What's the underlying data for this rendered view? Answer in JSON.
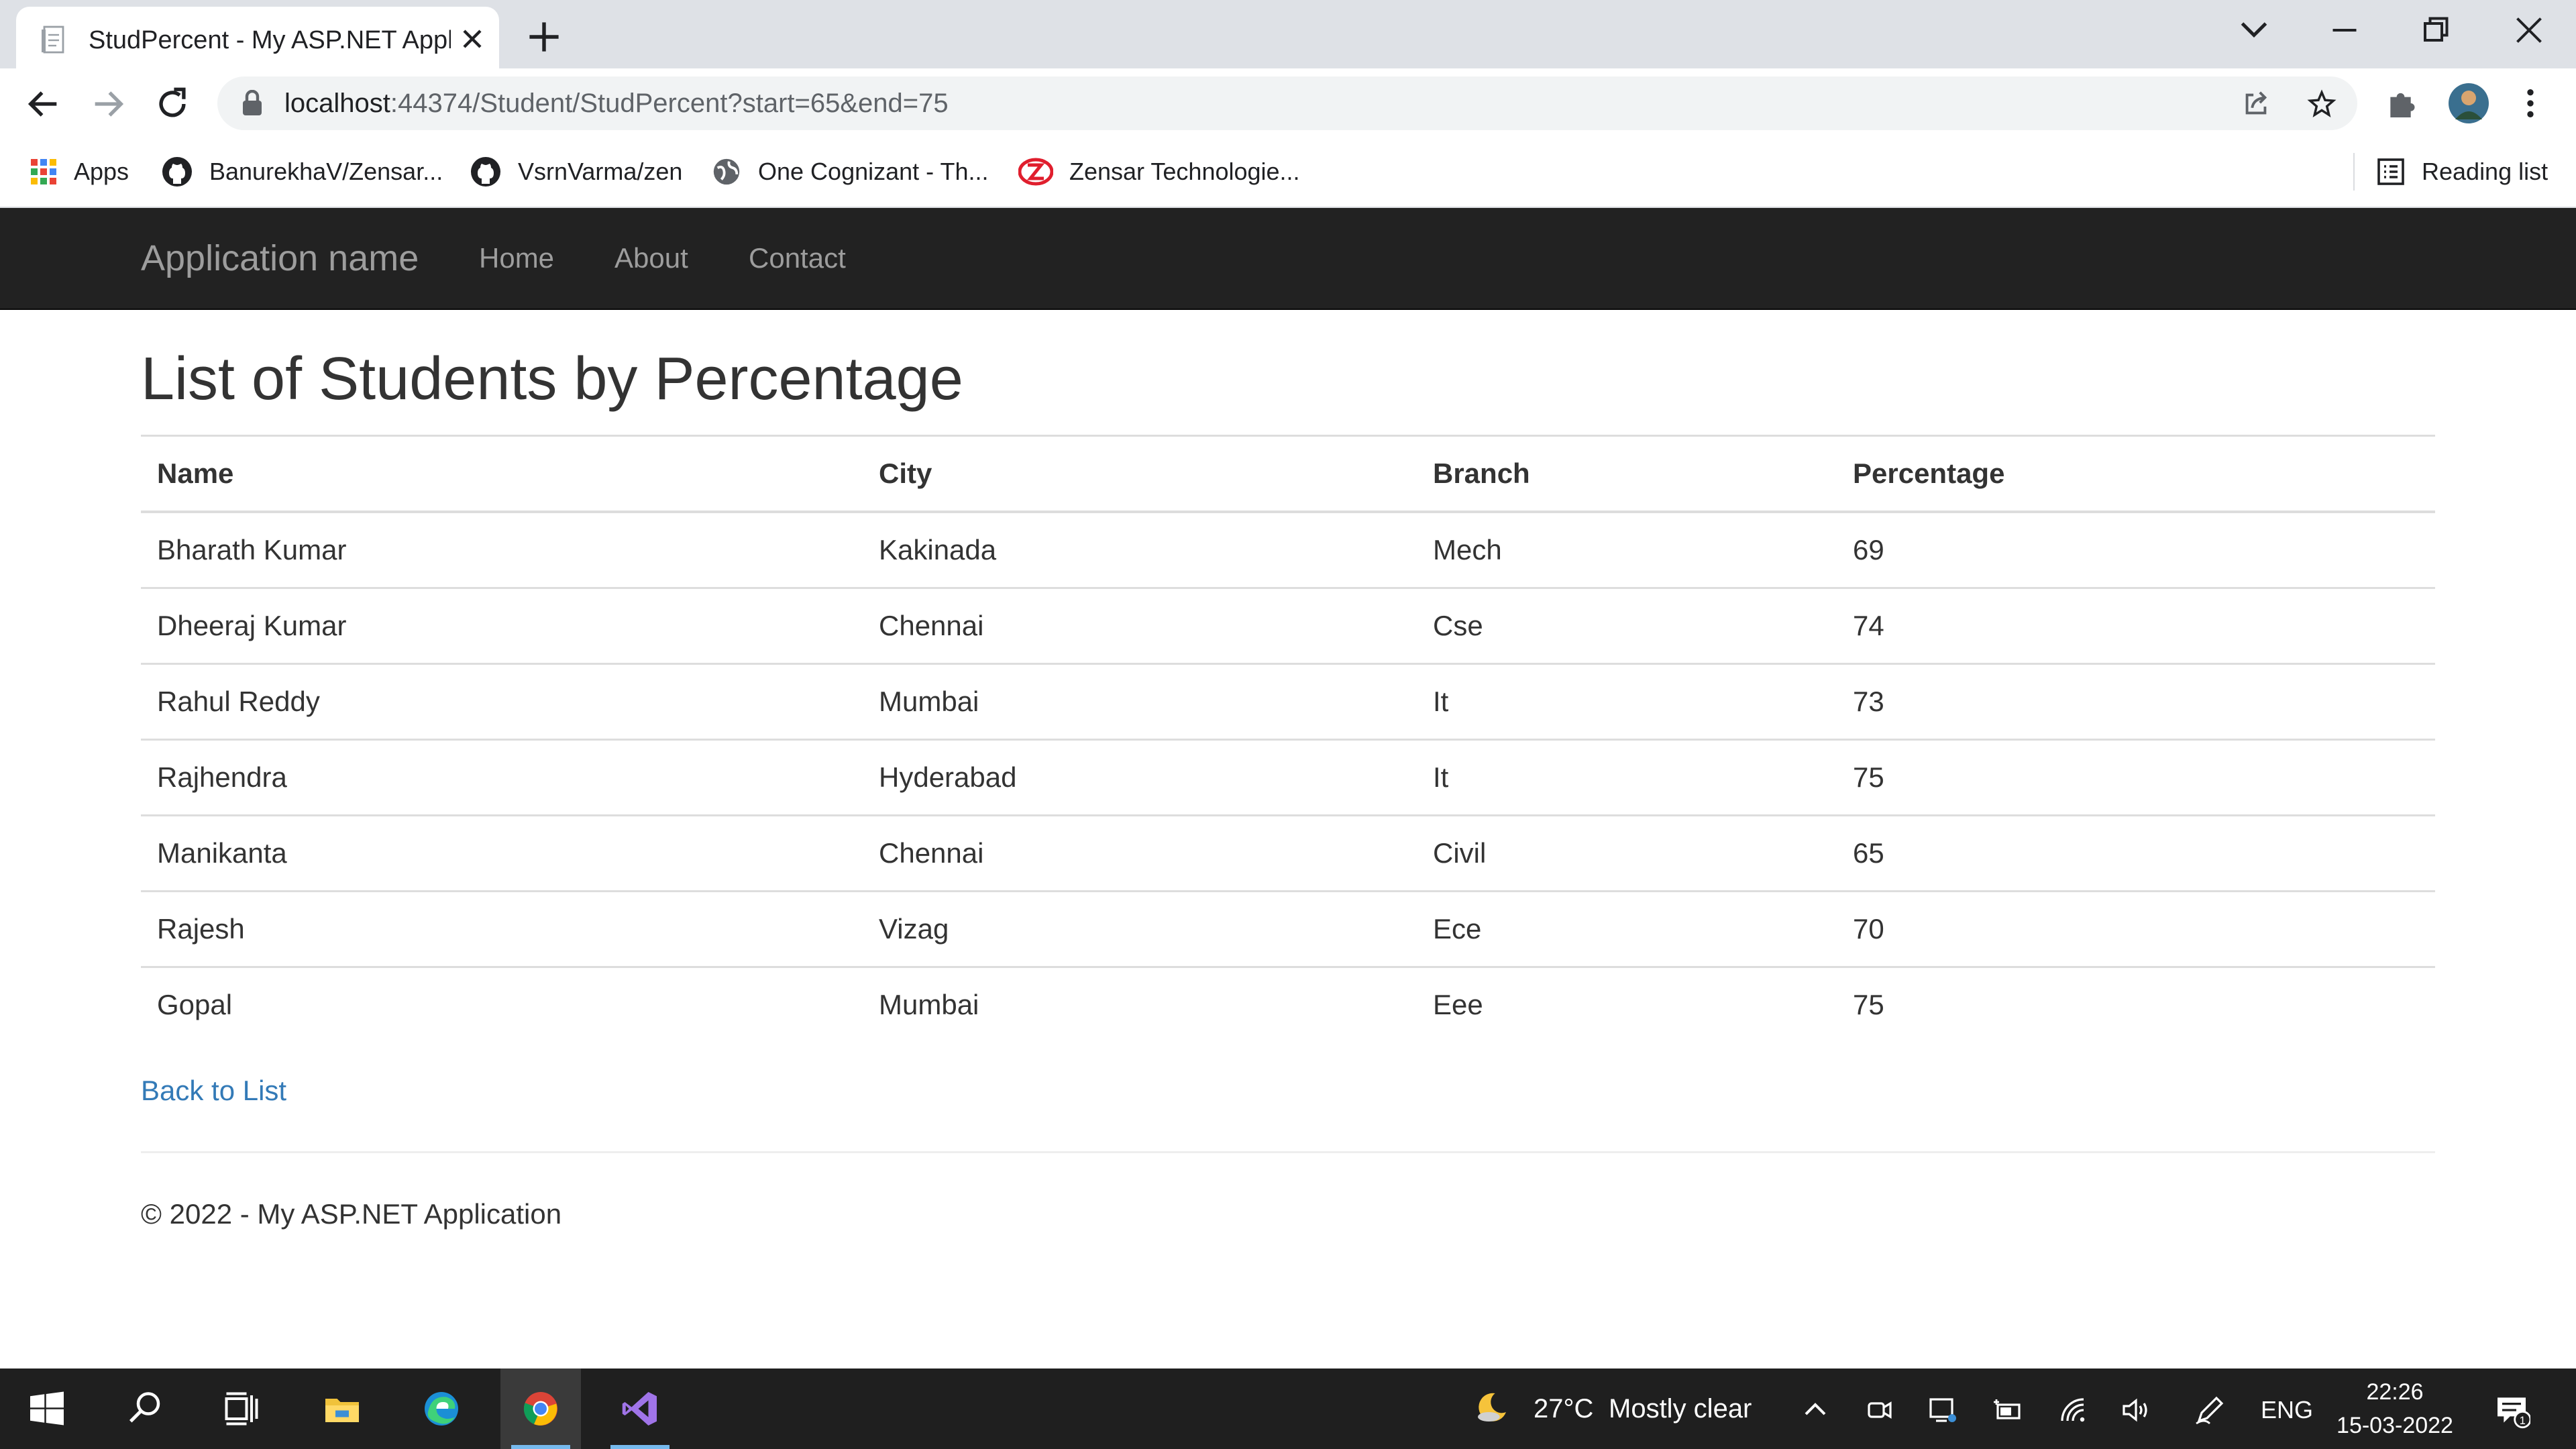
{
  "browser": {
    "tab_title": "StudPercent - My ASP.NET Applic",
    "url_host": "localhost",
    "url_rest": ":44374/Student/StudPercent?start=65&end=75",
    "bookmarks": [
      {
        "label": "Apps",
        "icon": "apps-grid-icon"
      },
      {
        "label": "BanurekhaV/Zensar...",
        "icon": "github-icon"
      },
      {
        "label": "VsrnVarma/zen",
        "icon": "github-icon"
      },
      {
        "label": "One Cognizant - Th...",
        "icon": "globe-icon"
      },
      {
        "label": "Zensar Technologie...",
        "icon": "zensar-logo-icon"
      }
    ],
    "reading_list": "Reading list"
  },
  "navbar": {
    "brand": "Application name",
    "links": [
      "Home",
      "About",
      "Contact"
    ]
  },
  "page": {
    "title": "List of Students by Percentage",
    "columns": [
      "Name",
      "City",
      "Branch",
      "Percentage"
    ],
    "rows": [
      [
        "Bharath Kumar",
        "Kakinada",
        "Mech",
        "69"
      ],
      [
        "Dheeraj Kumar",
        "Chennai",
        "Cse",
        "74"
      ],
      [
        "Rahul Reddy",
        "Mumbai",
        "It",
        "73"
      ],
      [
        "Rajhendra",
        "Hyderabad",
        "It",
        "75"
      ],
      [
        "Manikanta",
        "Chennai",
        "Civil",
        "65"
      ],
      [
        "Rajesh",
        "Vizag",
        "Ece",
        "70"
      ],
      [
        "Gopal",
        "Mumbai",
        "Eee",
        "75"
      ]
    ],
    "back_link": "Back to List",
    "footer": "© 2022 - My ASP.NET Application"
  },
  "taskbar": {
    "weather_temp": "27°C",
    "weather_text": "Mostly clear",
    "language": "ENG",
    "time": "22:26",
    "date": "15-03-2022",
    "notification_count": "1"
  },
  "colors": {
    "navbar_bg": "#222222",
    "nav_text": "#9d9d9d",
    "link": "#337ab7",
    "taskbar_bg": "#1f1f1f"
  }
}
